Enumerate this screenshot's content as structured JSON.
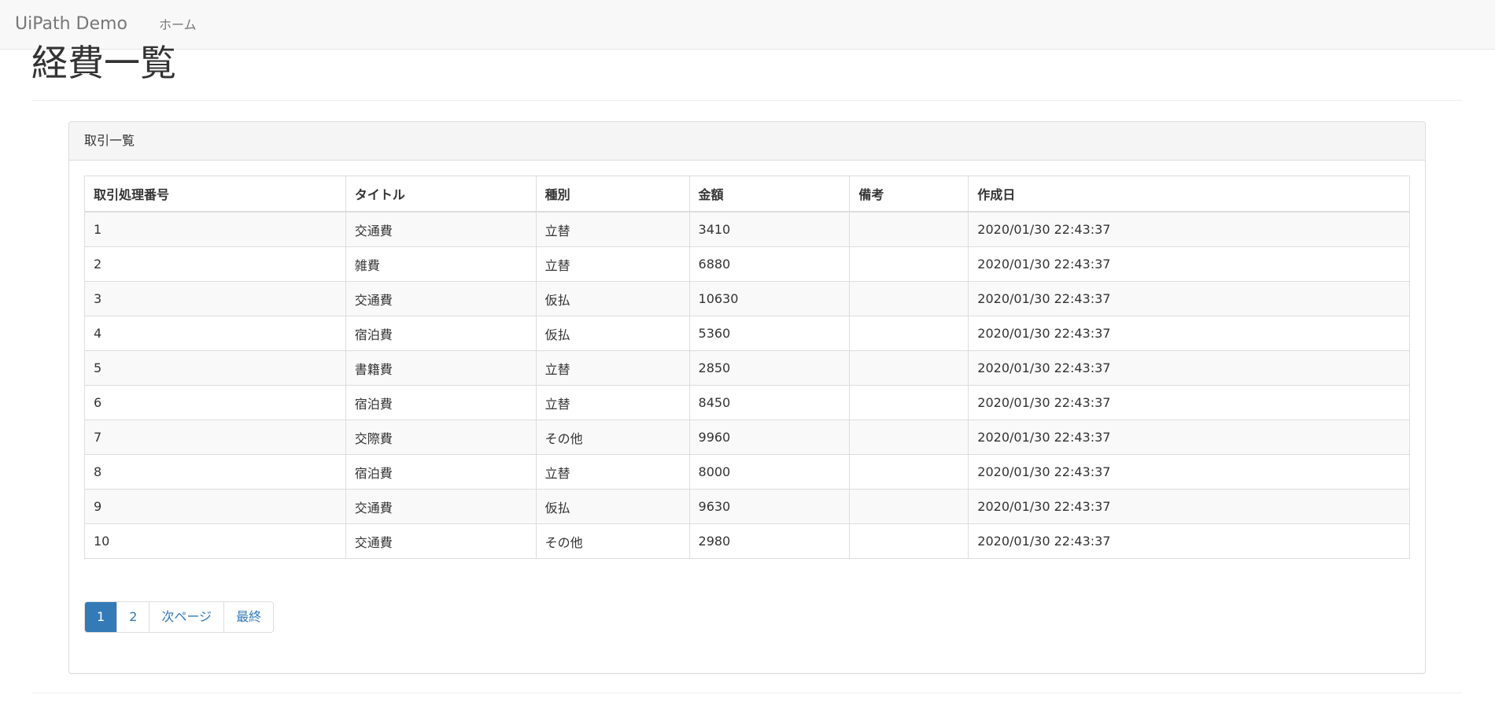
{
  "navbar": {
    "brand": "UiPath Demo",
    "home": "ホーム"
  },
  "page": {
    "title": "経費一覧"
  },
  "panel": {
    "heading": "取引一覧"
  },
  "table": {
    "columns": [
      "取引処理番号",
      "タイトル",
      "種別",
      "金額",
      "備考",
      "作成日"
    ],
    "rows": [
      [
        "1",
        "交通費",
        "立替",
        "3410",
        "",
        "2020/01/30 22:43:37"
      ],
      [
        "2",
        "雑費",
        "立替",
        "6880",
        "",
        "2020/01/30 22:43:37"
      ],
      [
        "3",
        "交通費",
        "仮払",
        "10630",
        "",
        "2020/01/30 22:43:37"
      ],
      [
        "4",
        "宿泊費",
        "仮払",
        "5360",
        "",
        "2020/01/30 22:43:37"
      ],
      [
        "5",
        "書籍費",
        "立替",
        "2850",
        "",
        "2020/01/30 22:43:37"
      ],
      [
        "6",
        "宿泊費",
        "立替",
        "8450",
        "",
        "2020/01/30 22:43:37"
      ],
      [
        "7",
        "交際費",
        "その他",
        "9960",
        "",
        "2020/01/30 22:43:37"
      ],
      [
        "8",
        "宿泊費",
        "立替",
        "8000",
        "",
        "2020/01/30 22:43:37"
      ],
      [
        "9",
        "交通費",
        "仮払",
        "9630",
        "",
        "2020/01/30 22:43:37"
      ],
      [
        "10",
        "交通費",
        "その他",
        "2980",
        "",
        "2020/01/30 22:43:37"
      ]
    ]
  },
  "pagination": {
    "items": [
      "1",
      "2",
      "次ページ",
      "最終"
    ],
    "active_index": 0
  },
  "colors": {
    "navbar_bg": "#f8f8f8",
    "link": "#337ab7",
    "active_page_bg": "#337ab7",
    "striped_row": "#f9f9f9"
  }
}
